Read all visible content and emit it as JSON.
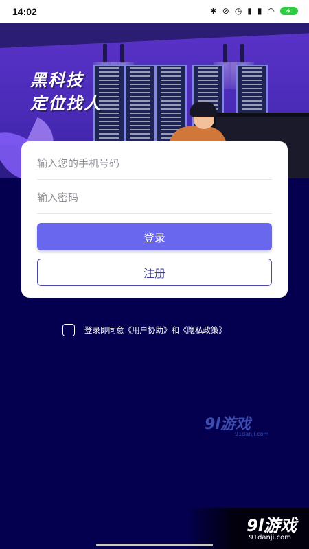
{
  "status_bar": {
    "time": "14:02",
    "icons": [
      "bluetooth-icon",
      "alarm-off-icon",
      "alarm-icon",
      "signal-icon",
      "signal-icon",
      "wifi-icon",
      "battery-charging-icon"
    ]
  },
  "hero": {
    "title_line1": "黑科技",
    "title_line2": "定位找人"
  },
  "login_form": {
    "phone_placeholder": "输入您的手机号码",
    "password_placeholder": "输入密码",
    "login_label": "登录",
    "register_label": "注册"
  },
  "agreement": {
    "prefix": "登录即同意",
    "user_agreement": "《用户协助》",
    "conjunction": "和",
    "privacy_policy": "《隐私政策》",
    "checked": false
  },
  "watermark": {
    "brand": "9l游戏",
    "domain": "91danji.com"
  },
  "colors": {
    "background": "#04004f",
    "primary_button": "#6a67ef",
    "card": "#ffffff",
    "hero": "#5b33c9"
  }
}
